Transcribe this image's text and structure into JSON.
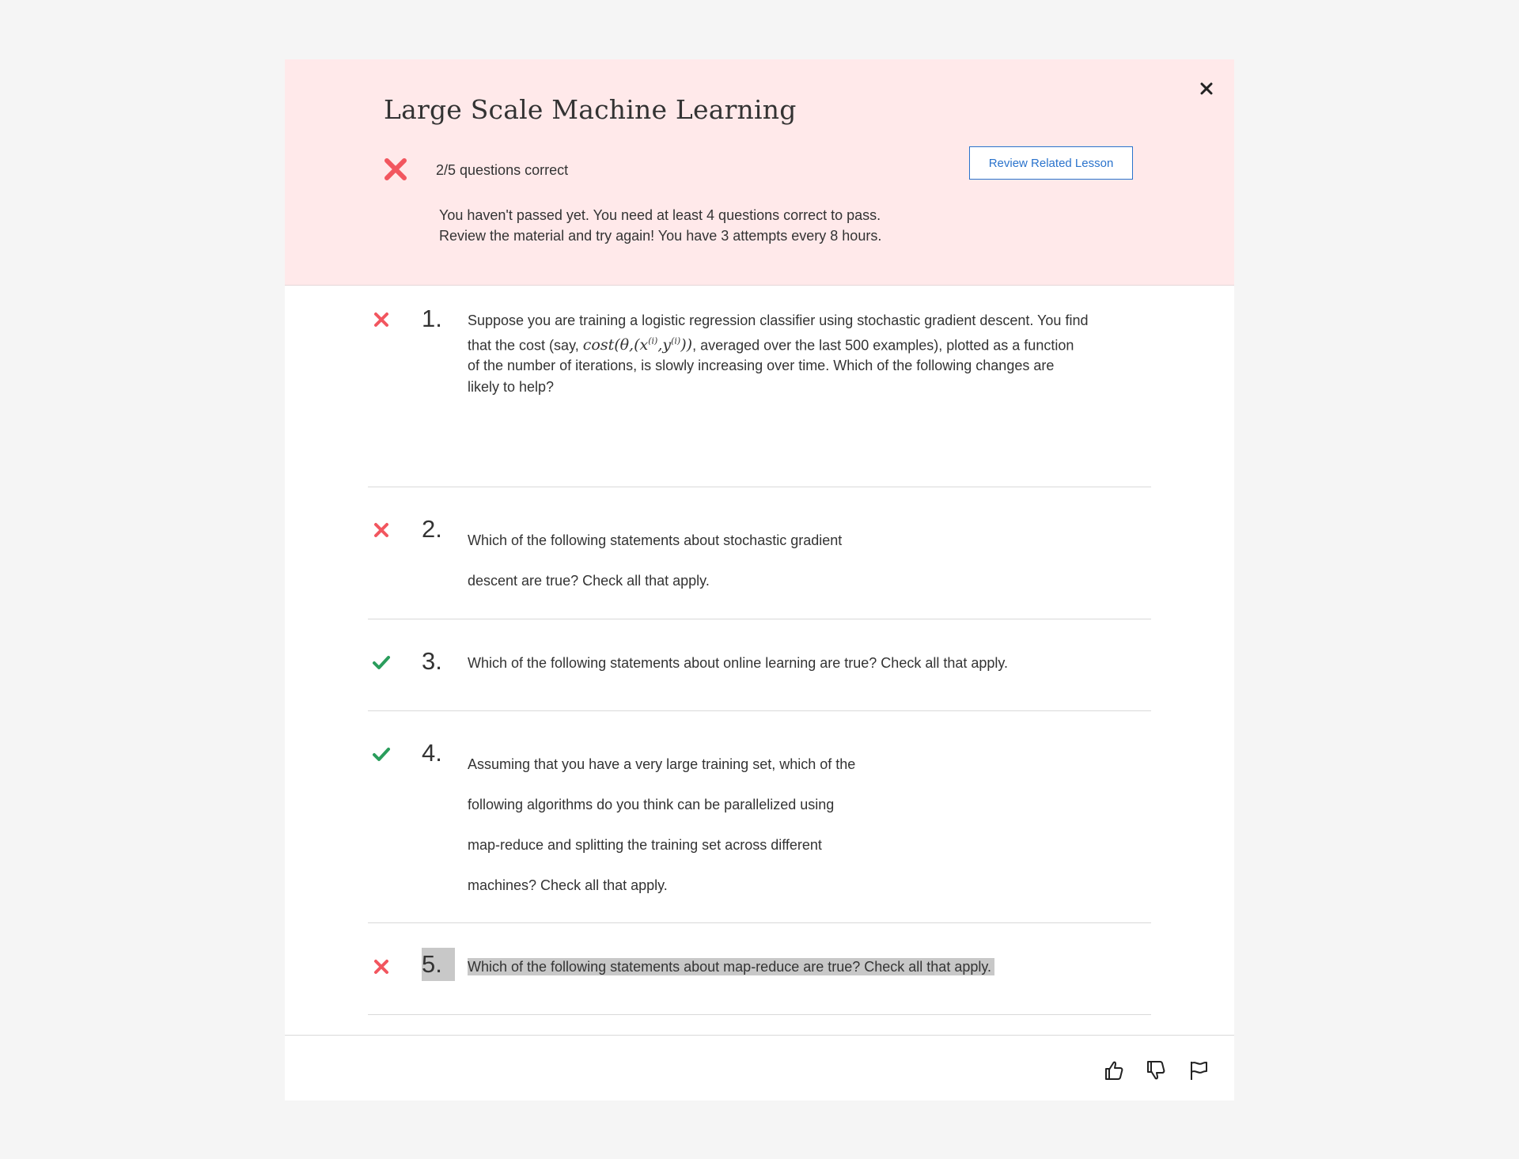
{
  "modal": {
    "title": "Large Scale Machine Learning",
    "score_text": "2/5 questions correct",
    "review_button": "Review Related Lesson",
    "message_line1": "You haven't passed yet. You need at least 4 questions correct to pass.",
    "message_line2": "Review the material and try again! You have 3 attempts every 8 hours.",
    "close_icon": "close-icon"
  },
  "questions": [
    {
      "number": "1.",
      "status": "incorrect",
      "line1": "Suppose you are training a logistic regression classifier using stochastic gradient descent. You find",
      "line2_before": "that the cost (say, ",
      "line2_math": "cost(θ,(x(i),y(i)))",
      "line2_after": ", averaged over the last 500 examples), plotted as a function",
      "line3": "of the number of iterations, is slowly increasing over time. Which of the following changes are",
      "line4": "likely to help?"
    },
    {
      "number": "2.",
      "status": "incorrect",
      "line1": "Which of the following statements about stochastic gradient",
      "line2": "descent are true? Check all that apply."
    },
    {
      "number": "3.",
      "status": "correct",
      "line1": "Which of the following statements about online learning are true? Check all that apply."
    },
    {
      "number": "4.",
      "status": "correct",
      "line1": "Assuming that you have a very large training set, which of the",
      "line2": "following algorithms do you think can be parallelized using",
      "line3": "map-reduce and splitting the training set across different",
      "line4": "machines? Check all that apply."
    },
    {
      "number": "5.",
      "status": "incorrect",
      "line1": "Which of the following statements about map-reduce are true? Check all that apply."
    }
  ],
  "colors": {
    "header_bg": "#ffe9ea",
    "incorrect": "#f2565f",
    "correct": "#2a9d5c",
    "link": "#2a73cc"
  },
  "footer": {
    "icons": [
      "thumbs-up-icon",
      "thumbs-down-icon",
      "flag-icon"
    ]
  }
}
